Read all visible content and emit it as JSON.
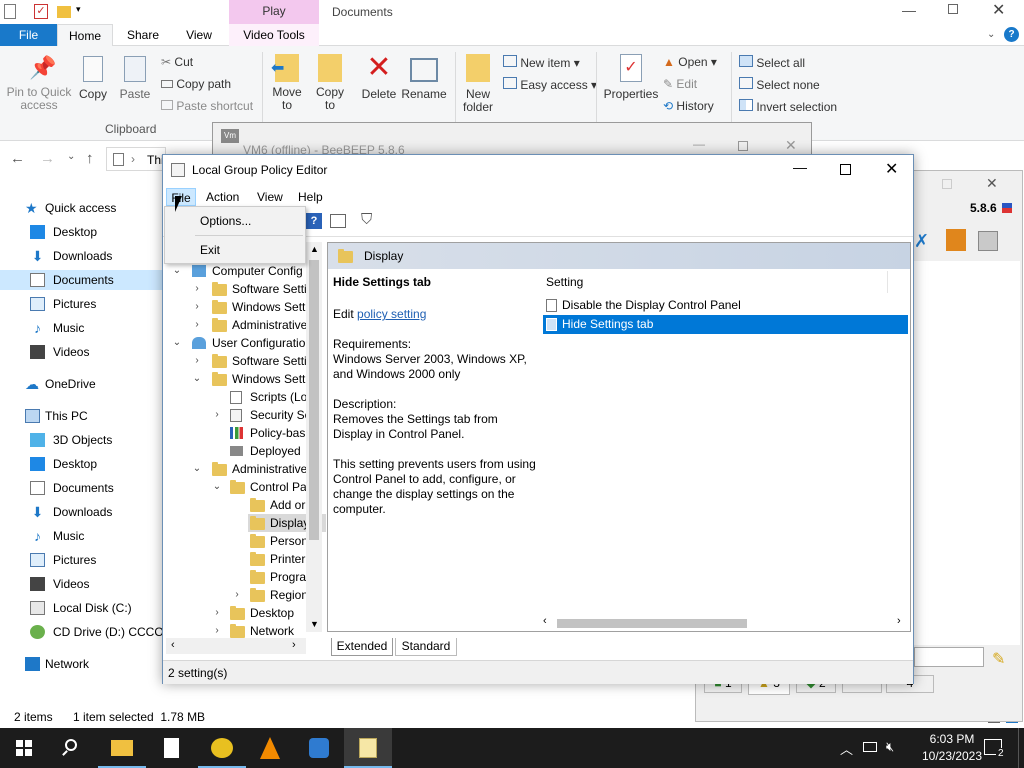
{
  "explorer": {
    "tabs": {
      "file": "File",
      "home": "Home",
      "share": "Share",
      "view": "View",
      "play_group": "Play",
      "video_tools": "Video Tools",
      "window_title": "Documents"
    },
    "ribbon": {
      "pin": "Pin to Quick access",
      "copy": "Copy",
      "paste": "Paste",
      "cut": "Cut",
      "copy_path": "Copy path",
      "paste_shortcut": "Paste shortcut",
      "clipboard_group": "Clipboard",
      "move_to": "Move to",
      "copy_to": "Copy to",
      "delete": "Delete",
      "rename": "Rename",
      "new_folder": "New folder",
      "new_item": "New item",
      "easy_access": "Easy access",
      "properties": "Properties",
      "open": "Open",
      "edit": "Edit",
      "history": "History",
      "select_all": "Select all",
      "select_none": "Select none",
      "invert_selection": "Invert selection"
    },
    "address_partial": "Thi",
    "nav": {
      "quick_access": "Quick access",
      "desktop": "Desktop",
      "downloads": "Downloads",
      "documents": "Documents",
      "pictures": "Pictures",
      "music": "Music",
      "videos": "Videos",
      "onedrive": "OneDrive",
      "this_pc": "This PC",
      "objects3d": "3D Objects",
      "pc_desktop": "Desktop",
      "pc_documents": "Documents",
      "pc_downloads": "Downloads",
      "pc_music": "Music",
      "pc_pictures": "Pictures",
      "pc_videos": "Videos",
      "local_disk": "Local Disk (C:)",
      "cd_drive": "CD Drive (D:) CCCOM",
      "network": "Network"
    },
    "status": {
      "items": "2 items",
      "selected": "1 item selected  1.78 MB"
    }
  },
  "beebeep": {
    "title": "VM6 (offline) - BeeBEEP 5.8.6",
    "version": "5.8.6",
    "tab1": "1",
    "tab3": "3",
    "tab2": "2",
    "tab4": "4"
  },
  "gpe": {
    "title": "Local Group Policy Editor",
    "menu": {
      "file": "File",
      "action": "Action",
      "view": "View",
      "help": "Help"
    },
    "file_menu": {
      "options": "Options...",
      "exit": "Exit"
    },
    "tree": {
      "computer_config": "Computer Config",
      "software_settings_1": "Software Setti",
      "windows_settings_1": "Windows Sett",
      "administrative_1": "Administrative",
      "user_config": "User Configuratio",
      "software_settings_2": "Software Setti",
      "windows_settings_2": "Windows Sett",
      "scripts": "Scripts (Lo",
      "security": "Security Se",
      "policy_based": "Policy-bas",
      "deployed": "Deployed",
      "administrative_2": "Administrative",
      "control_panel": "Control Pa",
      "add_or": "Add or",
      "display": "Display",
      "personalization": "Person",
      "printers": "Printer",
      "programs": "Progra",
      "regional": "Region",
      "desktop": "Desktop",
      "network": "Network"
    },
    "header": "Display",
    "detail": {
      "title": "Hide Settings tab",
      "edit_prefix": "Edit ",
      "edit_link": "policy setting",
      "req_label": "Requirements:",
      "req_text": "Windows Server 2003, Windows XP, and Windows 2000 only",
      "desc_label": "Description:",
      "desc_text": "Removes the Settings tab from Display in Control Panel.",
      "desc_text2": "This setting prevents users from using Control Panel to add, configure, or change the display settings on the computer."
    },
    "list": {
      "column": "Setting",
      "rows": [
        "Disable the Display Control Panel",
        "Hide Settings tab"
      ]
    },
    "tabs": {
      "extended": "Extended",
      "standard": "Standard"
    },
    "status": "2 setting(s)"
  },
  "taskbar": {
    "time": "6:03 PM",
    "date": "10/23/2023",
    "notifications": "2"
  },
  "colors": {
    "selection": "#0078d7",
    "play_tab": "#f3c8ee",
    "file_tab": "#1979ca"
  }
}
